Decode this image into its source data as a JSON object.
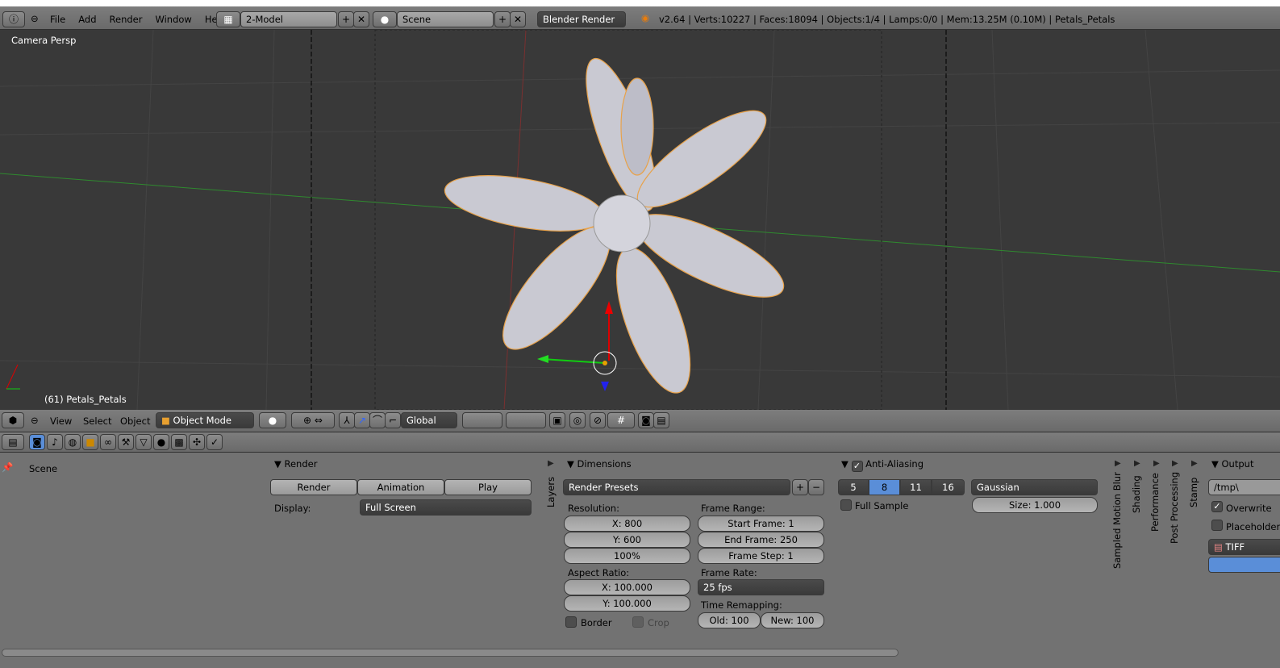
{
  "top": {
    "menus": [
      "File",
      "Add",
      "Render",
      "Window",
      "Help"
    ],
    "layout": "2-Model",
    "scene": "Scene",
    "engine": "Blender Render",
    "stats": "v2.64 | Verts:10227 | Faces:18094 | Objects:1/4 | Lamps:0/0 | Mem:13.25M (0.10M) | Petals_Petals"
  },
  "viewport": {
    "view_name": "Camera Persp",
    "object_label": "(61) Petals_Petals"
  },
  "view_header": {
    "menus": [
      "View",
      "Select",
      "Object"
    ],
    "mode": "Object Mode",
    "orientation": "Global"
  },
  "outliner": {
    "scene": "Scene"
  },
  "render": {
    "title": "Render",
    "render_btn": "Render",
    "animation_btn": "Animation",
    "play_btn": "Play",
    "display_label": "Display:",
    "display_value": "Full Screen"
  },
  "layers_tab": "Layers",
  "dimensions": {
    "title": "Dimensions",
    "presets": "Render Presets",
    "resolution_label": "Resolution:",
    "res_x": "X: 800",
    "res_y": "Y: 600",
    "res_pct": "100%",
    "aspect_label": "Aspect Ratio:",
    "aspect_x": "X: 100.000",
    "aspect_y": "Y: 100.000",
    "border": "Border",
    "crop": "Crop",
    "frame_range_label": "Frame Range:",
    "start": "Start Frame: 1",
    "end": "End Frame: 250",
    "step": "Frame Step: 1",
    "frame_rate_label": "Frame Rate:",
    "fps": "25 fps",
    "remap_label": "Time Remapping:",
    "old": "Old: 100",
    "new": "New: 100"
  },
  "aa": {
    "title": "Anti-Aliasing",
    "samples": [
      "5",
      "8",
      "11",
      "16"
    ],
    "selected": "8",
    "filter": "Gaussian",
    "size": "Size: 1.000",
    "full_sample": "Full Sample"
  },
  "collapsed": [
    "Sampled Motion Blur",
    "Shading",
    "Performance",
    "Post Processing",
    "Stamp"
  ],
  "output": {
    "title": "Output",
    "path": "/tmp\\",
    "overwrite": "Overwrite",
    "placeholders": "Placeholders",
    "format": "TIFF"
  },
  "colors": {
    "accent": "#5a8ed8",
    "viewport": "#393939"
  }
}
